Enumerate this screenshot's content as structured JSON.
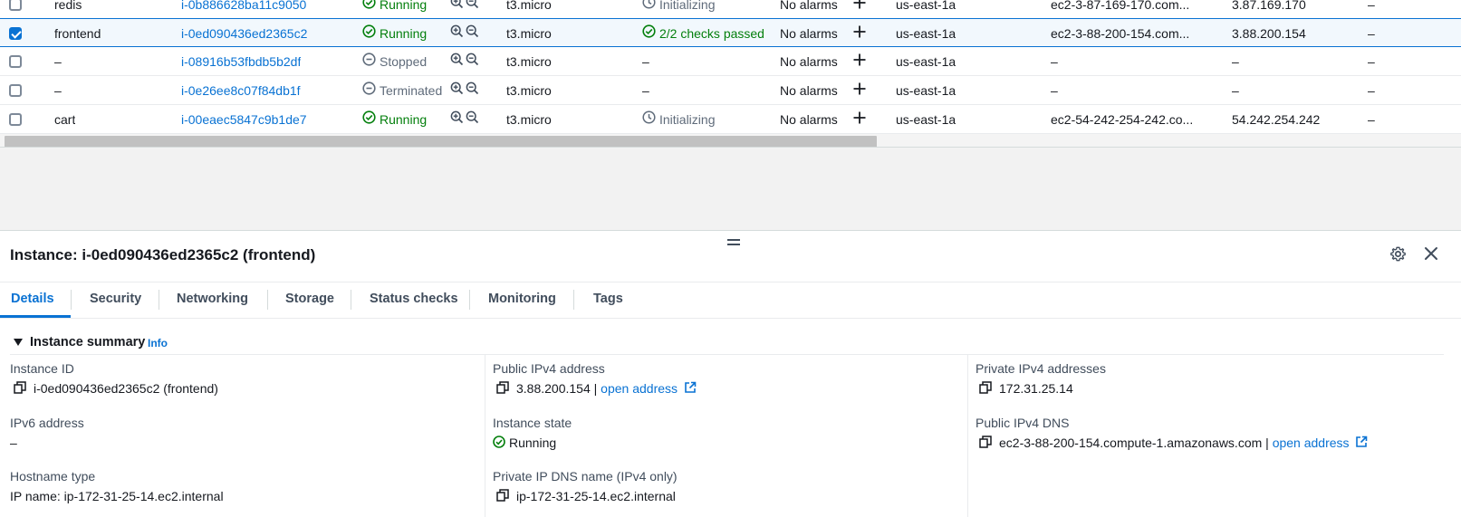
{
  "table": {
    "rows": [
      {
        "name": "redis",
        "instance_id": "i-0b886628ba11c9050",
        "state": "Running",
        "type": "t3.micro",
        "status": "Initializing",
        "alarms": "No alarms",
        "az": "us-east-1a",
        "dns": "ec2-3-87-169-170.com...",
        "ip": "3.87.169.170",
        "extra": "–",
        "checked": false
      },
      {
        "name": "frontend",
        "instance_id": "i-0ed090436ed2365c2",
        "state": "Running",
        "type": "t3.micro",
        "status": "2/2 checks passed",
        "alarms": "No alarms",
        "az": "us-east-1a",
        "dns": "ec2-3-88-200-154.com...",
        "ip": "3.88.200.154",
        "extra": "–",
        "checked": true
      },
      {
        "name": "–",
        "instance_id": "i-08916b53fbdb5b2df",
        "state": "Stopped",
        "type": "t3.micro",
        "status": "–",
        "alarms": "No alarms",
        "az": "us-east-1a",
        "dns": "–",
        "ip": "–",
        "extra": "–",
        "checked": false
      },
      {
        "name": "–",
        "instance_id": "i-0e26ee8c07f84db1f",
        "state": "Terminated",
        "type": "t3.micro",
        "status": "–",
        "alarms": "No alarms",
        "az": "us-east-1a",
        "dns": "–",
        "ip": "–",
        "extra": "–",
        "checked": false
      },
      {
        "name": "cart",
        "instance_id": "i-00eaec5847c9b1de7",
        "state": "Running",
        "type": "t3.micro",
        "status": "Initializing",
        "alarms": "No alarms",
        "az": "us-east-1a",
        "dns": "ec2-54-242-254-242.co...",
        "ip": "54.242.254.242",
        "extra": "–",
        "checked": false
      }
    ]
  },
  "panel": {
    "title": "Instance: i-0ed090436ed2365c2 (frontend)",
    "tabs": [
      "Details",
      "Security",
      "Networking",
      "Storage",
      "Status checks",
      "Monitoring",
      "Tags"
    ],
    "active_tab": "Details",
    "section_title": "Instance summary",
    "section_info": "Info",
    "fields": {
      "instance_id_label": "Instance ID",
      "instance_id_value": "i-0ed090436ed2365c2 (frontend)",
      "ipv6_label": "IPv6 address",
      "ipv6_value": "–",
      "hostname_label": "Hostname type",
      "hostname_value": "IP name: ip-172-31-25-14.ec2.internal",
      "public_ipv4_label": "Public IPv4 address",
      "public_ipv4_value": "3.88.200.154",
      "public_ipv4_sep": "|",
      "public_ipv4_link": "open address",
      "state_label": "Instance state",
      "state_value": "Running",
      "private_dns_label": "Private IP DNS name (IPv4 only)",
      "private_dns_value": "ip-172-31-25-14.ec2.internal",
      "private_ipv4_label": "Private IPv4 addresses",
      "private_ipv4_value": "172.31.25.14",
      "public_dns_label": "Public IPv4 DNS",
      "public_dns_value": "ec2-3-88-200-154.compute-1.amazonaws.com",
      "public_dns_sep": "|",
      "public_dns_link": "open address"
    }
  },
  "colors": {
    "link": "#0972d3",
    "success": "#037f0c",
    "text": "#16191f",
    "muted": "#414d5c"
  }
}
